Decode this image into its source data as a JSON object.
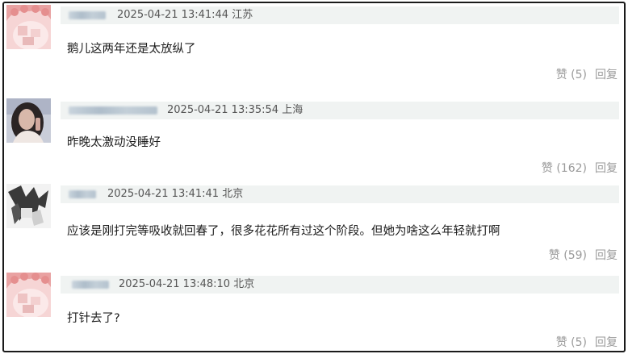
{
  "comments": [
    {
      "avatar_icon": "pink-cartoon-avatar-icon",
      "time": "2025-04-21 13:41:44",
      "location": "江苏",
      "text": "鹅儿这两年还是太放纵了",
      "like_label": "赞",
      "likes": "(5)",
      "reply_label": "回复"
    },
    {
      "avatar_icon": "woman-photo-avatar-icon",
      "time": "2025-04-21 13:35:54",
      "location": "上海",
      "text": "昨晚太激动没睡好",
      "like_label": "赞",
      "likes": "(162)",
      "reply_label": "回复"
    },
    {
      "avatar_icon": "anime-sketch-avatar-icon",
      "time": "2025-04-21 13:41:41",
      "location": "北京",
      "text": "应该是刚打完等吸收就回春了，很多花花所有过这个阶段。但她为啥这么年轻就打啊",
      "like_label": "赞",
      "likes": "(59)",
      "reply_label": "回复"
    },
    {
      "avatar_icon": "pink-cartoon-avatar-icon",
      "time": "2025-04-21 13:48:10",
      "location": "北京",
      "text": "打针去了?",
      "like_label": "赞",
      "likes": "(5)",
      "reply_label": "回复"
    }
  ],
  "colors": {
    "meta_bar": "#f0f3f2",
    "text": "#1c1c1c",
    "muted": "#9a9a9a",
    "timestamp": "#555555"
  }
}
